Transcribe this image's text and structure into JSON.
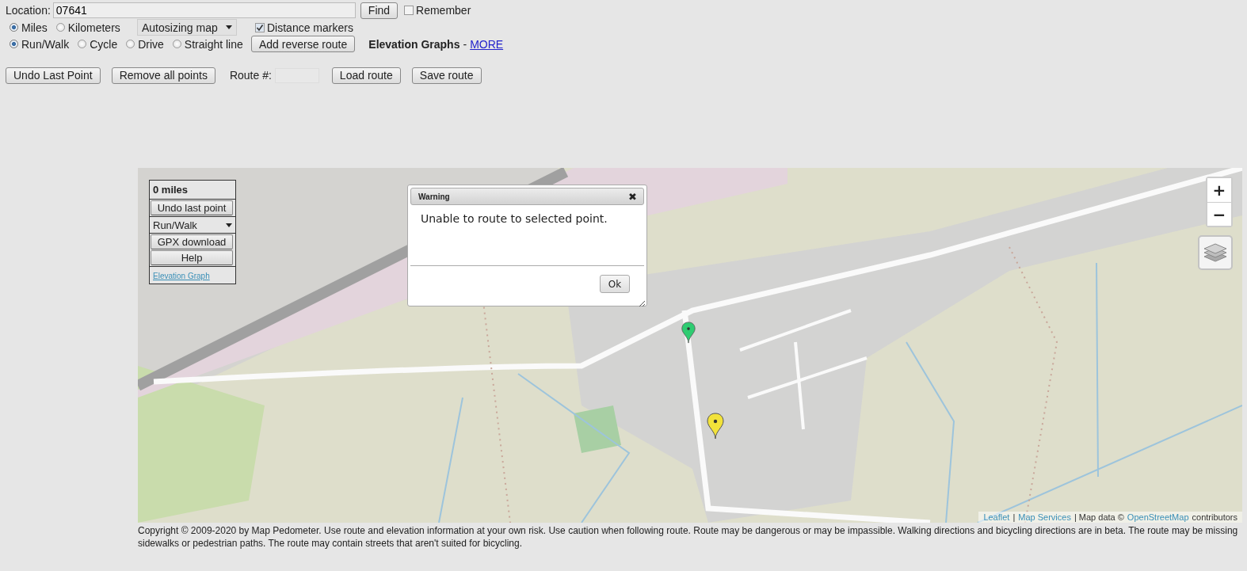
{
  "location": {
    "label": "Location:",
    "value": "07641"
  },
  "find_button": "Find",
  "remember": {
    "label": "Remember",
    "checked": false
  },
  "units": [
    {
      "label": "Miles",
      "selected": true
    },
    {
      "label": "Kilometers",
      "selected": false
    }
  ],
  "map_size": {
    "value": "Autosizing map"
  },
  "distance_markers": {
    "label": "Distance markers",
    "checked": true
  },
  "modes": [
    {
      "label": "Run/Walk",
      "selected": true
    },
    {
      "label": "Cycle",
      "selected": false
    },
    {
      "label": "Drive",
      "selected": false
    },
    {
      "label": "Straight line",
      "selected": false
    }
  ],
  "reverse_button": "Add reverse route",
  "elevation": {
    "label": "Elevation Graphs",
    "separator": "-",
    "link": "MORE"
  },
  "actions": {
    "undo_button": "Undo Last Point",
    "remove_button": "Remove all points",
    "route_label": "Route #:",
    "load_button": "Load route",
    "save_button": "Save route"
  },
  "map": {
    "kind": "picture",
    "panel": {
      "distance": "0 miles",
      "undo_button": "Undo last point",
      "mode_select": "Run/Walk",
      "gpx_button": "GPX download",
      "help_button": "Help",
      "elevation_link": "Elevation Graph"
    },
    "dialog": {
      "title": "Warning",
      "close": "✖",
      "message": "Unable to route to selected point.",
      "ok_button": "Ok"
    },
    "zoom": {
      "in": "+",
      "out": "−"
    },
    "markers": [
      {
        "color": "#2ecc71"
      },
      {
        "color": "#f2e23a"
      }
    ],
    "attribution": {
      "leaflet": "Leaflet",
      "sep1": "|",
      "services": "Map Services",
      "sep2": "| Map data ©",
      "osm": "OpenStreetMap",
      "rest": "contributors"
    }
  },
  "footer": "Copyright © 2009-2020 by Map Pedometer. Use route and elevation information at your own risk. Use caution when following route. Route may be dangerous or may be impassible. Walking directions and bicycling directions are in beta. The route may be missing sidewalks or pedestrian paths. The route may contain streets that aren't suited for bicycling."
}
